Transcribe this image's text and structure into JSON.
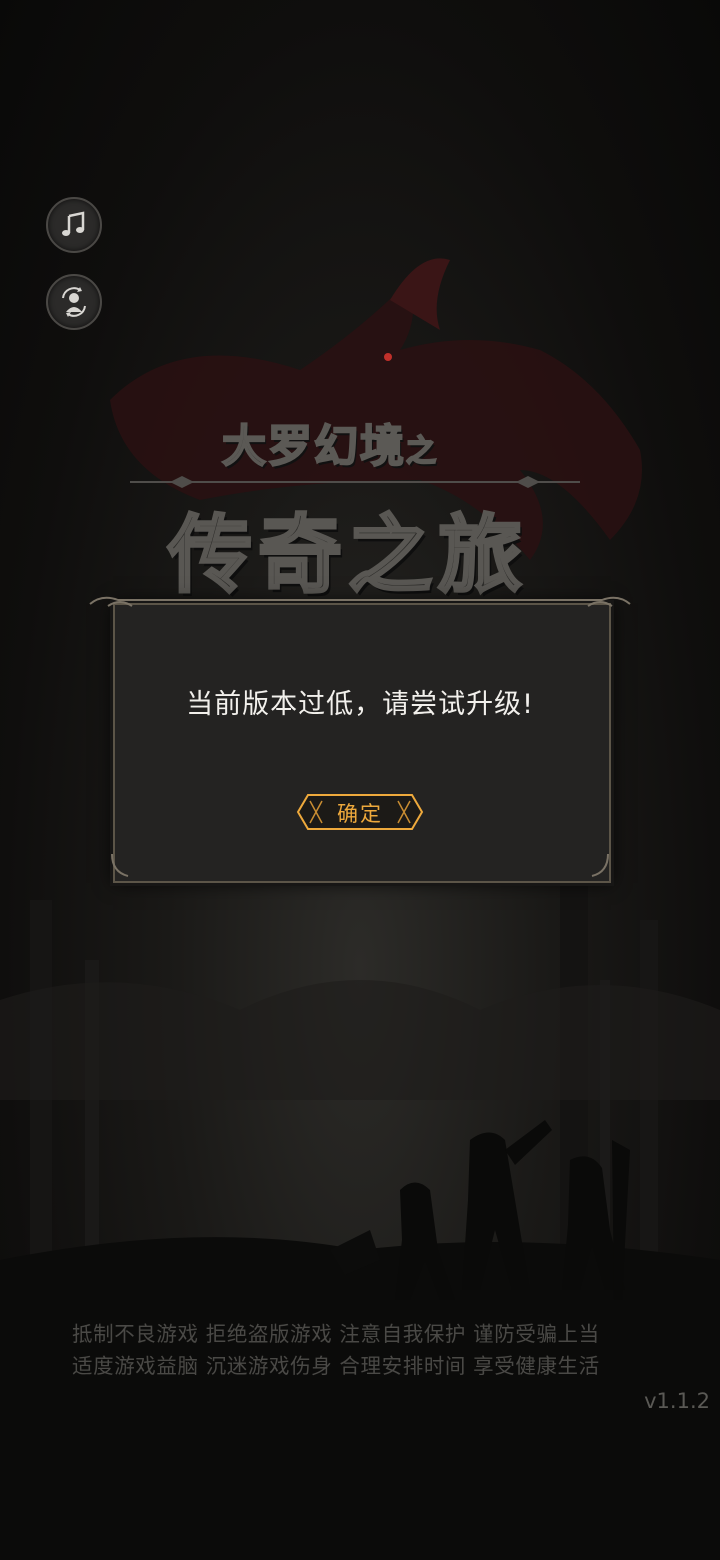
{
  "controls": {
    "music_icon": "music-note-icon",
    "account_icon": "account-switch-icon"
  },
  "logo": {
    "title_top": "大罗幻境",
    "title_top_suffix": "之",
    "title_main": "传奇之旅"
  },
  "dialog": {
    "message": "当前版本过低，请尝试升级!",
    "confirm_label": "确定"
  },
  "health_notice": {
    "line1": "抵制不良游戏 拒绝盗版游戏 注意自我保护 谨防受骗上当",
    "line2": "适度游戏益脑 沉迷游戏伤身 合理安排时间 享受健康生活"
  },
  "version": "v1.1.2",
  "colors": {
    "accent": "#eea93c",
    "dialog_bg": "#242322",
    "dialog_border": "#5c5548",
    "dragon": "#3b1414"
  }
}
